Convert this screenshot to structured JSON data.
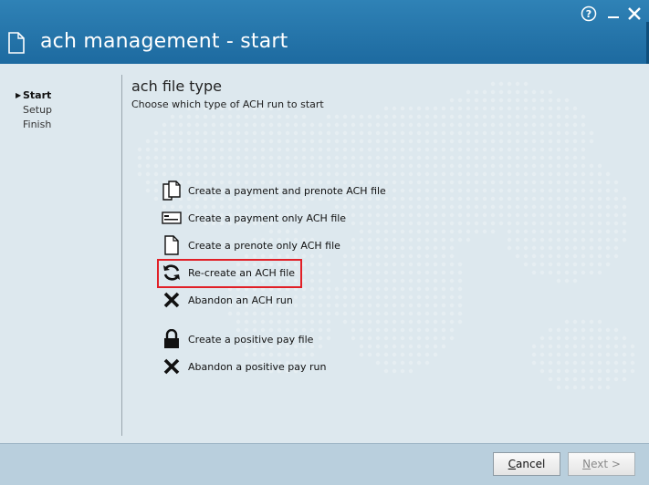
{
  "window": {
    "title": "ach management - start",
    "help_icon": "help-icon",
    "minimize_icon": "minimize-icon",
    "close_icon": "close-icon"
  },
  "steps": [
    {
      "label": "Start",
      "active": true
    },
    {
      "label": "Setup",
      "active": false
    },
    {
      "label": "Finish",
      "active": false
    }
  ],
  "main": {
    "heading": "ach file type",
    "subheading": "Choose which type of ACH run to start"
  },
  "options": [
    {
      "label": "Create a payment and prenote ACH file",
      "icon": "documents-icon"
    },
    {
      "label": "Create a payment only ACH file",
      "icon": "check-card-icon"
    },
    {
      "label": "Create a prenote only ACH file",
      "icon": "document-icon"
    },
    {
      "label": "Re-create an ACH file",
      "icon": "refresh-icon",
      "highlighted": true
    },
    {
      "label": "Abandon an ACH run",
      "icon": "x-icon"
    },
    {
      "label": "Create a positive pay file",
      "icon": "lock-icon"
    },
    {
      "label": "Abandon a positive pay run",
      "icon": "x-icon"
    }
  ],
  "footer": {
    "cancel_label": "Cancel",
    "next_label": "Next >"
  },
  "colors": {
    "titlebar": "#2079b0",
    "highlight_border": "#e11f26",
    "footer": "#b9cfdd"
  }
}
